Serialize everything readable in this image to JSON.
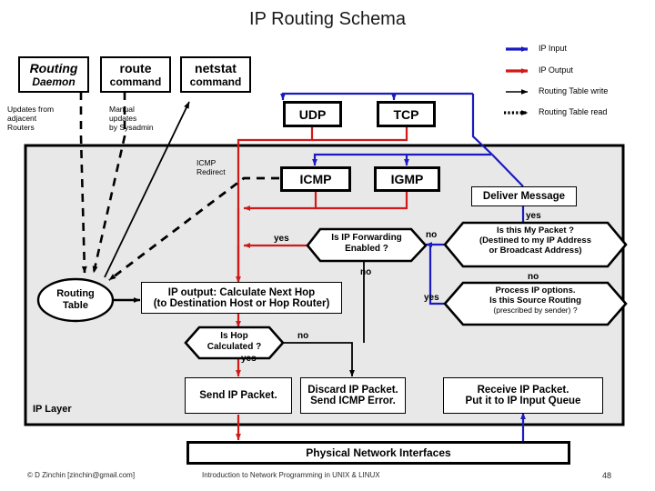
{
  "title": "IP Routing Schema",
  "legend": {
    "items": [
      {
        "label": "IP Input",
        "color": "#1a1ac0",
        "style": "solid",
        "icon": "arrow-right-icon"
      },
      {
        "label": "IP Output",
        "color": "#d01a1a",
        "style": "solid",
        "icon": "arrow-right-icon"
      },
      {
        "label": "Routing Table write",
        "color": "#000000",
        "style": "solid",
        "icon": "arrow-right-icon"
      },
      {
        "label": "Routing Table read",
        "color": "#000000",
        "style": "dotted",
        "icon": "arrow-right-dotted-icon"
      }
    ]
  },
  "top_boxes": [
    {
      "line1": "Routing",
      "line2": "Daemon"
    },
    {
      "line1": "route",
      "line2": "command"
    },
    {
      "line1": "netstat",
      "line2": "command"
    }
  ],
  "notes": {
    "updates_adjacent": "Updates from\nadjacent\nRouters",
    "manual_updates": "Manual\nupdates\nby Sysadmin",
    "icmp_redirect": "ICMP\nRedirect",
    "ip_layer": "IP Layer"
  },
  "protocols": [
    {
      "name": "UDP"
    },
    {
      "name": "TCP"
    },
    {
      "name": "ICMP"
    },
    {
      "name": "IGMP"
    }
  ],
  "routing_table": {
    "line1": "Routing",
    "line2": "Table"
  },
  "action_boxes": {
    "deliver_message": "Deliver Message",
    "ip_output": "IP output: Calculate Next Hop\n(to Destination Host or Hop Router)",
    "send_ip_packet": "Send IP Packet.",
    "discard_ip_packet": "Discard IP Packet.\nSend ICMP Error.",
    "receive_ip_packet": "Receive IP Packet.\nPut it to IP Input Queue",
    "physical_network": "Physical Network Interfaces"
  },
  "decisions": {
    "ip_forwarding": {
      "line1": "Is IP Forwarding",
      "line2": "Enabled ?"
    },
    "my_packet": {
      "line1": "Is this My Packet ?",
      "line2": "(Destined to my IP Address",
      "line3": "or Broadcast Address)"
    },
    "source_routing": {
      "line1": "Process IP options.",
      "line2": "Is this Source Routing",
      "line3": "(prescribed by sender) ?"
    },
    "hop_calculated": {
      "line1": "Is Hop",
      "line2": "Calculated ?"
    }
  },
  "flags": {
    "fwd_yes": "yes",
    "fwd_no": "no",
    "mypkt_yes": "yes",
    "mypkt_no": "no",
    "srcrt_no": "no",
    "srcrt_yes": "yes",
    "hop_no": "no",
    "hop_yes": "yes"
  },
  "footer": {
    "copyright": "© D Zinchin [zinchin@gmail.com]",
    "course": "Introduction to Network Programming in UNIX & LINUX",
    "page": "48"
  },
  "colors": {
    "ip_input": "#1a1ac0",
    "ip_output": "#d01a1a",
    "routing_write": "#000000",
    "ip_layer_bg": "#e8e8e8"
  }
}
